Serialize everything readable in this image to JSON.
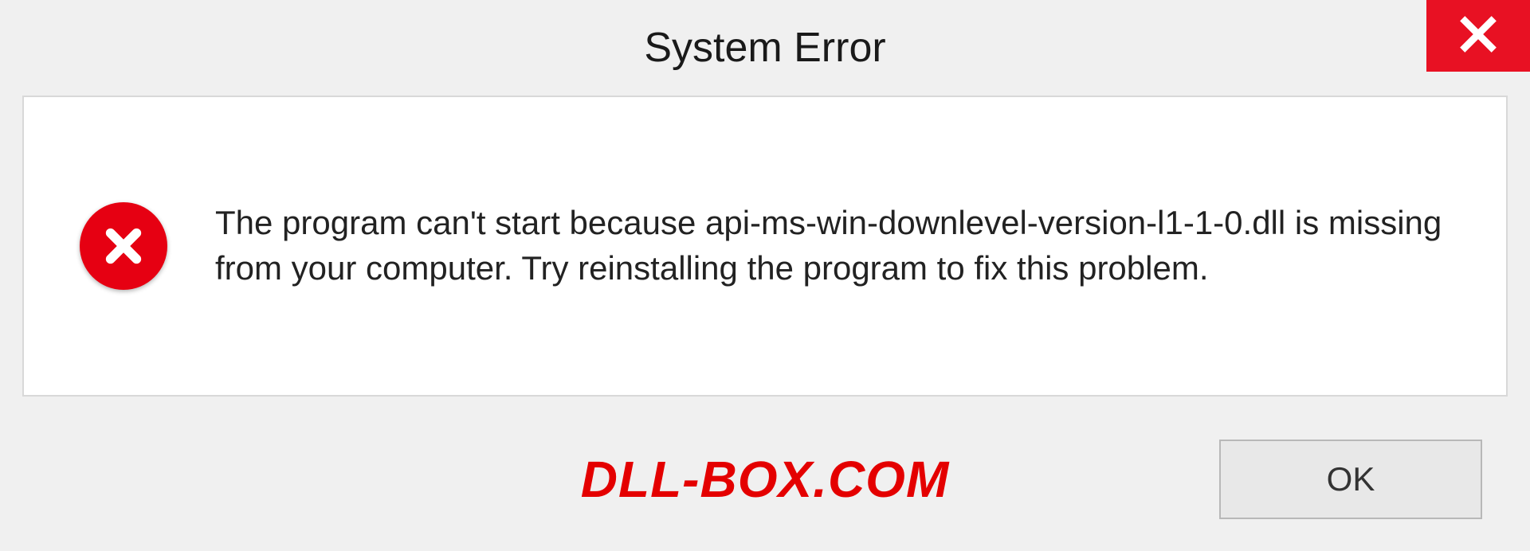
{
  "titlebar": {
    "title": "System Error"
  },
  "dialog": {
    "message": "The program can't start because api-ms-win-downlevel-version-l1-1-0.dll is missing from your computer. Try reinstalling the program to fix this problem."
  },
  "footer": {
    "watermark": "DLL-BOX.COM",
    "ok_label": "OK"
  },
  "colors": {
    "close_bg": "#e81123",
    "error_icon": "#e60012",
    "watermark": "#e40000"
  }
}
